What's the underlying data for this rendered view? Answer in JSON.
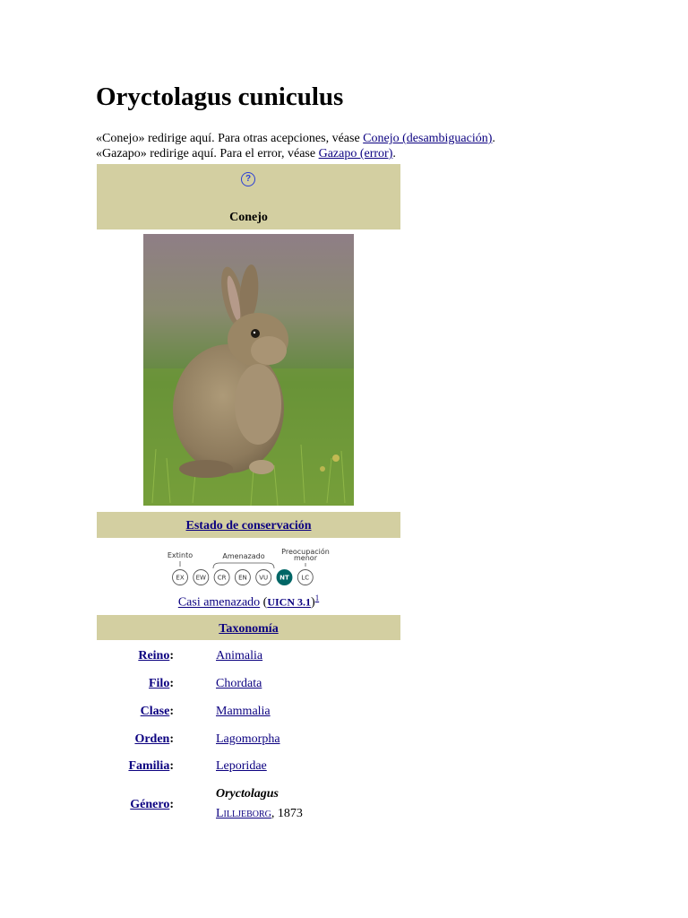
{
  "title": "Oryctolagus cuniculus",
  "hatnotes": [
    {
      "prefix": "«Conejo» redirige aquí. Para otras acepciones, véase ",
      "link": "Conejo (desambiguación)",
      "suffix": "."
    },
    {
      "prefix": "«Gazapo» redirige aquí. Para el error, véase ",
      "link": "Gazapo (error)",
      "suffix": "."
    }
  ],
  "infobox": {
    "help_glyph": "?",
    "common_name": "Conejo",
    "conservation": {
      "header": "Estado de conservación",
      "scale_labels": {
        "extinct": "Extinto",
        "threatened": "Amenazado",
        "least_concern_1": "Preocupación",
        "least_concern_2": "menor"
      },
      "categories": [
        "EX",
        "EW",
        "CR",
        "EN",
        "VU",
        "NT",
        "LC"
      ],
      "selected": "NT",
      "status_text": "Casi amenazado",
      "source_open": " (",
      "source": "UICN 3.1",
      "source_close": ")",
      "ref": "1"
    },
    "taxonomy": {
      "header": "Taxonomía",
      "colon": ":",
      "rows": [
        {
          "rank": "Reino",
          "value": "Animalia"
        },
        {
          "rank": "Filo",
          "value": "Chordata"
        },
        {
          "rank": "Clase",
          "value": "Mammalia"
        },
        {
          "rank": "Orden",
          "value": "Lagomorpha"
        },
        {
          "rank": "Familia",
          "value": "Leporidae"
        },
        {
          "rank": "Género",
          "value": "Oryctolagus",
          "authority": "Lilljeborg",
          "year": ", 1873"
        }
      ]
    }
  },
  "colors": {
    "infobox_band": "#d3cfa1",
    "link": "#0b0080",
    "selected_status": "#006666"
  }
}
